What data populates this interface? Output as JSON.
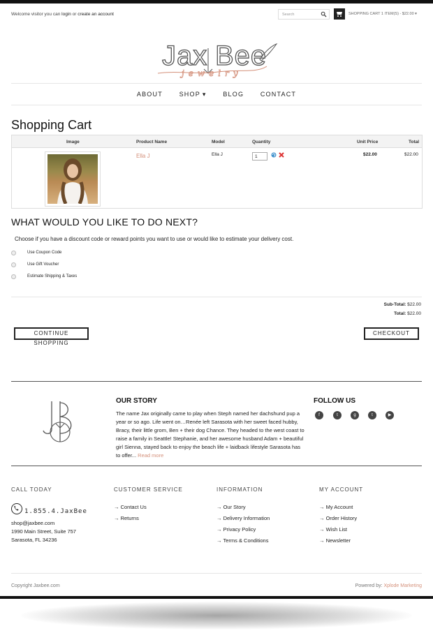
{
  "topbar": {
    "welcome_prefix": "Welcome visitor you can",
    "login": "login",
    "or": "or",
    "create_account": "create an account",
    "search_placeholder": "Search",
    "cart_summary": "SHOPPING CART 1 ITEM(S) - $22.00"
  },
  "logo": {
    "brand": "JaxBee",
    "sub": "jewelry"
  },
  "nav": {
    "about": "ABOUT",
    "shop": "SHOP",
    "blog": "BLOG",
    "contact": "CONTACT"
  },
  "cart": {
    "title": "Shopping Cart",
    "headers": {
      "image": "Image",
      "name": "Product Name",
      "model": "Model",
      "quantity": "Quantity",
      "unit_price": "Unit Price",
      "total": "Total"
    },
    "item": {
      "name": "Ella J",
      "model": "Ella J",
      "quantity": "1",
      "unit_price": "$22.00",
      "total": "$22.00"
    }
  },
  "next": {
    "title": "WHAT WOULD YOU LIKE TO DO NEXT?",
    "description": "Choose if you have a discount code or reward points you want to use or would like to estimate your delivery cost.",
    "options": [
      "Use Coupon Code",
      "Use Gift Voucher",
      "Estimate Shipping & Taxes"
    ]
  },
  "totals": {
    "subtotal_label": "Sub-Total:",
    "subtotal": "$22.00",
    "total_label": "Total:",
    "total": "$22.00"
  },
  "buttons": {
    "continue": "CONTINUE SHOPPING",
    "checkout": "CHECKOUT"
  },
  "story": {
    "title": "OUR STORY",
    "text": "The name Jax originally came to play when Steph named her dachshund pup a year or so ago. Life went on…Renée left Sarasota with her sweet faced hubby, Bracy, their little grom, Ben + their dog Chance. They headed to the west coast to raise a family in Seattle! Stephanie, and her awesome husband Adam + beautiful girl Sienna, stayed back to enjoy the beach life + laidback lifestyle Sarasota has to offer...",
    "read_more": "Read more"
  },
  "follow": {
    "title": "FOLLOW US",
    "icons": [
      "facebook-icon",
      "twitter-icon",
      "google-plus-icon",
      "tumblr-icon",
      "youtube-icon"
    ]
  },
  "footer": {
    "call_title": "CALL TODAY",
    "phone": "1.855.4.JaxBee",
    "email": "shop@jaxbee.com",
    "address1": "1990 Main Street, Suite 757",
    "address2": "Sarasota, FL 34236",
    "customer_service": {
      "title": "CUSTOMER SERVICE",
      "links": [
        "Contact Us",
        "Returns"
      ]
    },
    "information": {
      "title": "INFORMATION",
      "links": [
        "Our Story",
        "Delivery Information",
        "Privacy Policy",
        "Terms & Conditions"
      ]
    },
    "my_account": {
      "title": "MY ACCOUNT",
      "links": [
        "My Account",
        "Order History",
        "Wish List",
        "Newsletter"
      ]
    },
    "copyright": "Copyright Jaxbee.com",
    "powered_by": "Powered by:",
    "powered_name": "Xplode Marketing"
  },
  "colors": {
    "accent": "#d4907a",
    "dark": "#222222"
  }
}
